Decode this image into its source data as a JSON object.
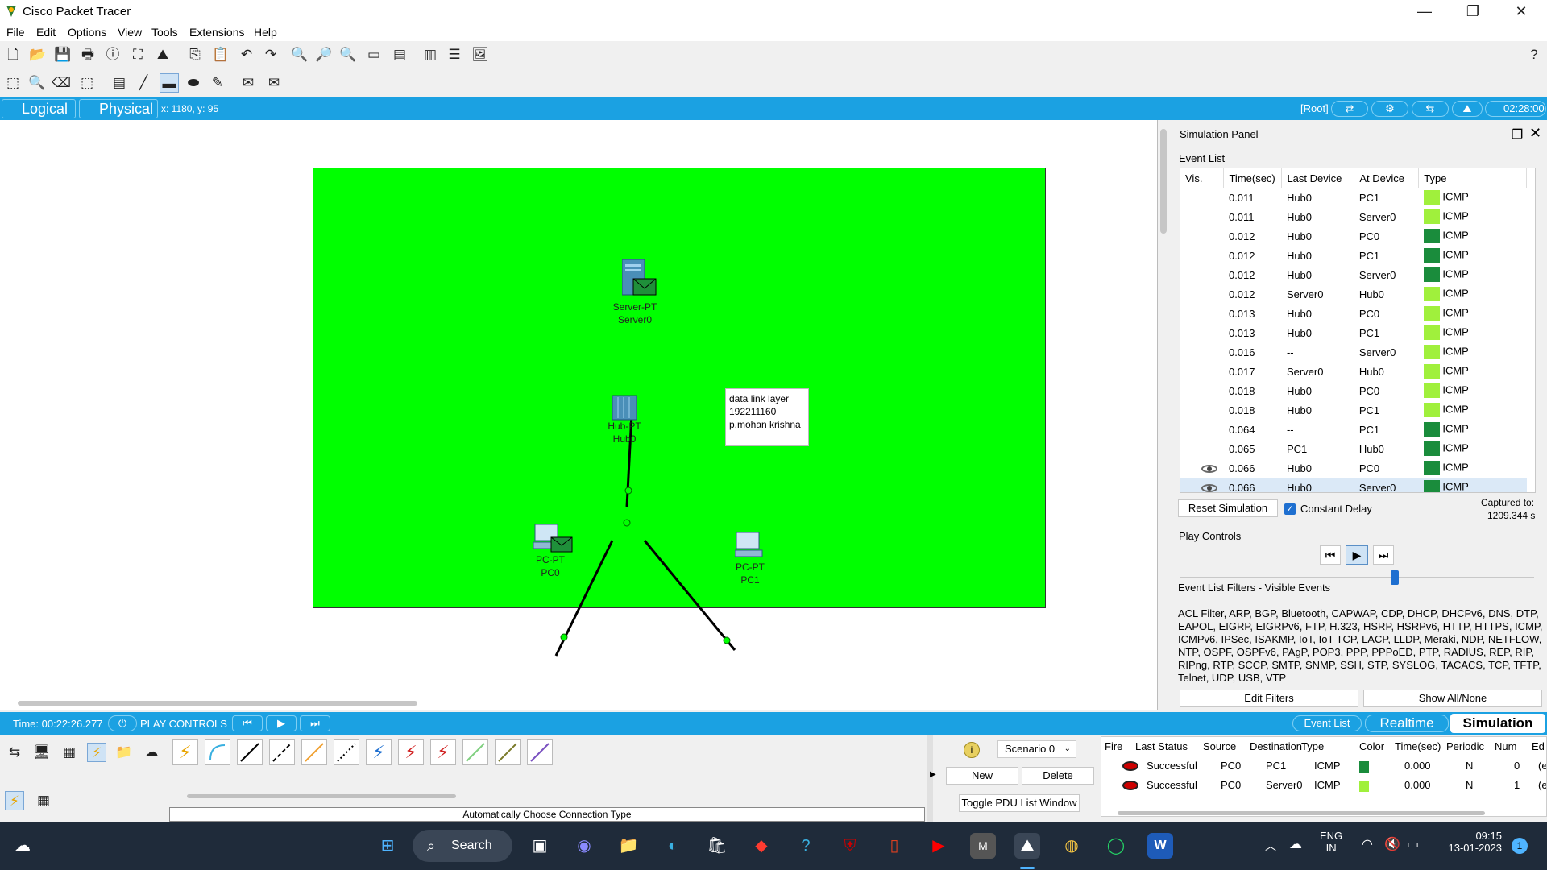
{
  "window": {
    "title": "Cisco Packet Tracer",
    "min": "—",
    "restore": "❐",
    "close": "✕"
  },
  "menu": [
    "File",
    "Edit",
    "Options",
    "View",
    "Tools",
    "Extensions",
    "Help"
  ],
  "modebar": {
    "logical": "Logical",
    "physical": "Physical",
    "coords": "x: 1180, y: 95",
    "root": "[Root]",
    "clock": "02:28:00"
  },
  "workspace": {
    "note": [
      "data link layer",
      "192211160",
      "p.mohan krishna"
    ],
    "devices": {
      "server": {
        "type": "Server-PT",
        "name": "Server0"
      },
      "hub": {
        "type": "Hub-PT",
        "name": "Hub0"
      },
      "pc0": {
        "type": "PC-PT",
        "name": "PC0"
      },
      "pc1": {
        "type": "PC-PT",
        "name": "PC1"
      }
    }
  },
  "sim_panel": {
    "title": "Simulation Panel",
    "event_list_label": "Event List",
    "columns": [
      "Vis.",
      "Time(sec)",
      "Last Device",
      "At Device",
      "Type"
    ],
    "events": [
      {
        "vis": "",
        "time": "0.011",
        "last": "Hub0",
        "at": "PC1",
        "color": "#a0f03c",
        "type": "ICMP"
      },
      {
        "vis": "",
        "time": "0.011",
        "last": "Hub0",
        "at": "Server0",
        "color": "#a0f03c",
        "type": "ICMP"
      },
      {
        "vis": "",
        "time": "0.012",
        "last": "Hub0",
        "at": "PC0",
        "color": "#1a8c3c",
        "type": "ICMP"
      },
      {
        "vis": "",
        "time": "0.012",
        "last": "Hub0",
        "at": "PC1",
        "color": "#1a8c3c",
        "type": "ICMP"
      },
      {
        "vis": "",
        "time": "0.012",
        "last": "Hub0",
        "at": "Server0",
        "color": "#1a8c3c",
        "type": "ICMP"
      },
      {
        "vis": "",
        "time": "0.012",
        "last": "Server0",
        "at": "Hub0",
        "color": "#a0f03c",
        "type": "ICMP"
      },
      {
        "vis": "",
        "time": "0.013",
        "last": "Hub0",
        "at": "PC0",
        "color": "#a0f03c",
        "type": "ICMP"
      },
      {
        "vis": "",
        "time": "0.013",
        "last": "Hub0",
        "at": "PC1",
        "color": "#a0f03c",
        "type": "ICMP"
      },
      {
        "vis": "",
        "time": "0.016",
        "last": "--",
        "at": "Server0",
        "color": "#a0f03c",
        "type": "ICMP"
      },
      {
        "vis": "",
        "time": "0.017",
        "last": "Server0",
        "at": "Hub0",
        "color": "#a0f03c",
        "type": "ICMP"
      },
      {
        "vis": "",
        "time": "0.018",
        "last": "Hub0",
        "at": "PC0",
        "color": "#a0f03c",
        "type": "ICMP"
      },
      {
        "vis": "",
        "time": "0.018",
        "last": "Hub0",
        "at": "PC1",
        "color": "#a0f03c",
        "type": "ICMP"
      },
      {
        "vis": "",
        "time": "0.064",
        "last": "--",
        "at": "PC1",
        "color": "#1a8c3c",
        "type": "ICMP"
      },
      {
        "vis": "",
        "time": "0.065",
        "last": "PC1",
        "at": "Hub0",
        "color": "#1a8c3c",
        "type": "ICMP"
      },
      {
        "vis": "eye",
        "time": "0.066",
        "last": "Hub0",
        "at": "PC0",
        "color": "#1a8c3c",
        "type": "ICMP"
      },
      {
        "vis": "eye",
        "time": "0.066",
        "last": "Hub0",
        "at": "Server0",
        "color": "#1a8c3c",
        "type": "ICMP"
      }
    ],
    "reset_label": "Reset Simulation",
    "constant_delay": "Constant Delay",
    "captured_label": "Captured to:",
    "captured_value": "1209.344 s",
    "play_controls_label": "Play Controls",
    "filters_label": "Event List Filters - Visible Events",
    "filters_text": "ACL Filter, ARP, BGP, Bluetooth, CAPWAP, CDP, DHCP, DHCPv6, DNS, DTP, EAPOL, EIGRP, EIGRPv6, FTP, H.323, HSRP, HSRPv6, HTTP, HTTPS, ICMP, ICMPv6, IPSec, ISAKMP, IoT, IoT TCP, LACP, LLDP, Meraki, NDP, NETFLOW, NTP, OSPF, OSPFv6, PAgP, POP3, PPP, PPPoED, PTP, RADIUS, REP, RIP, RIPng, RTP, SCCP, SMTP, SNMP, SSH, STP, SYSLOG, TACACS, TCP, TFTP, Telnet, UDP, USB, VTP",
    "edit_filters": "Edit Filters",
    "show_all": "Show All/None"
  },
  "timebar": {
    "time": "Time: 00:22:26.277",
    "play_controls": "PLAY CONTROLS",
    "event_list": "Event List",
    "realtime": "Realtime",
    "simulation": "Simulation"
  },
  "bottom": {
    "scenario": "Scenario 0",
    "new": "New",
    "delete": "Delete",
    "toggle_pdu": "Toggle PDU List Window",
    "connection_type": "Automatically Choose Connection Type",
    "pdu_columns": [
      "Fire",
      "Last Status",
      "Source",
      "Destination",
      "Type",
      "Color",
      "Time(sec)",
      "Periodic",
      "Num",
      "Ed"
    ],
    "pdus": [
      {
        "status": "Successful",
        "source": "PC0",
        "dest": "PC1",
        "type": "ICMP",
        "color": "#1a8c3c",
        "time": "0.000",
        "periodic": "N",
        "num": "0",
        "edit": "(e"
      },
      {
        "status": "Successful",
        "source": "PC0",
        "dest": "Server0",
        "type": "ICMP",
        "color": "#a0f03c",
        "time": "0.000",
        "periodic": "N",
        "num": "1",
        "edit": "(e"
      }
    ]
  },
  "taskbar": {
    "search": "Search",
    "lang1": "ENG",
    "lang2": "IN",
    "time": "09:15",
    "date": "13-01-2023",
    "badge": "1"
  }
}
